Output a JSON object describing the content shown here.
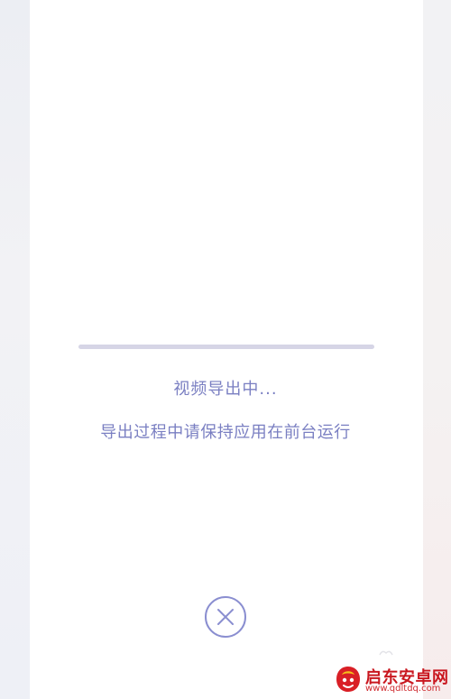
{
  "export": {
    "progress": 0,
    "title": "视频导出中...",
    "hint": "导出过程中请保持应用在前台运行"
  },
  "controls": {
    "cancel_icon": "close-icon"
  },
  "watermark": {
    "name": "启东安卓网",
    "url": "www.qdltdq.com"
  },
  "colors": {
    "accent": "#7a7fc2",
    "track": "#d6d5e6",
    "watermark_red": "#c9171f"
  }
}
